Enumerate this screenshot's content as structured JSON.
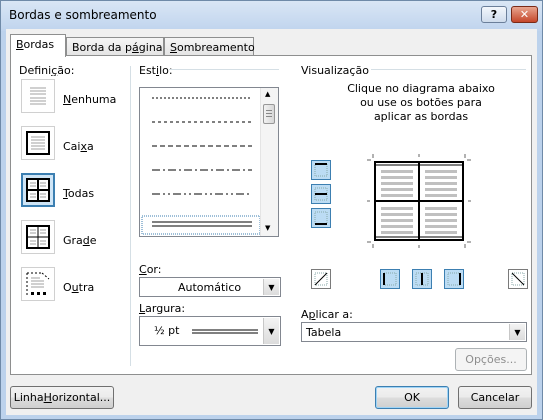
{
  "window": {
    "title": "Bordas e sombreamento",
    "help": "?",
    "close": "✕"
  },
  "tabs": [
    {
      "label_pre": "",
      "label_u": "B",
      "label_post": "ordas"
    },
    {
      "label_pre": "Borda da p",
      "label_u": "á",
      "label_post": "gina"
    },
    {
      "label_pre": "",
      "label_u": "S",
      "label_post": "ombreamento"
    }
  ],
  "definicao": {
    "heading_pre": "Defini",
    "heading_u": "ç",
    "heading_post": "ão:",
    "items": [
      {
        "pre": "",
        "u": "N",
        "post": "enhuma"
      },
      {
        "pre": "Cai",
        "u": "x",
        "post": "a"
      },
      {
        "pre": "",
        "u": "T",
        "post": "odas"
      },
      {
        "pre": "Gra",
        "u": "d",
        "post": "e"
      },
      {
        "pre": "O",
        "u": "u",
        "post": "tra"
      }
    ]
  },
  "estilo": {
    "heading_pre": "Est",
    "heading_u": "i",
    "heading_post": "lo:"
  },
  "cor": {
    "label_pre": "",
    "label_u": "C",
    "label_post": "or:",
    "value": "Automático"
  },
  "largura": {
    "label_pre": "",
    "label_u": "L",
    "label_post": "argura:",
    "value": "½ pt"
  },
  "visualizacao": {
    "heading": "Visualização",
    "hint": "Clique no diagrama abaixo ou use os botões para aplicar as bordas"
  },
  "aplicar": {
    "label_pre": "A",
    "label_u": "p",
    "label_post": "licar a:",
    "value": "Tabela"
  },
  "buttons": {
    "opcoes": "Opções...",
    "linha_pre": "Linha ",
    "linha_u": "H",
    "linha_post": "orizontal...",
    "ok": "OK",
    "cancelar": "Cancelar"
  },
  "colors": {
    "accent": "#3c7fb1",
    "selected_bg": "#cfe5f6"
  }
}
